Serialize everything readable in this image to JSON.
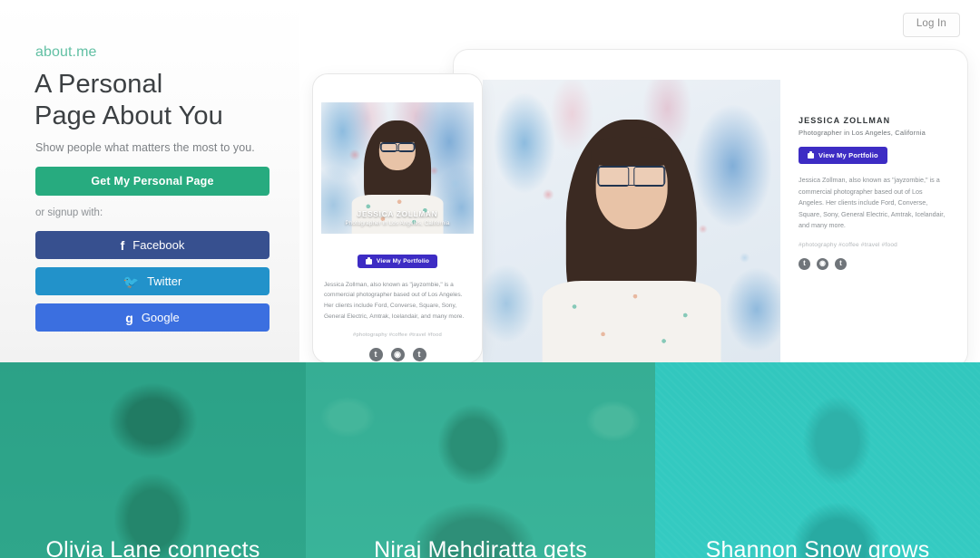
{
  "header": {
    "login_label": "Log In",
    "brand": "about.me"
  },
  "hero": {
    "headline_line1": "A Personal",
    "headline_line2": "Page About You",
    "subhead": "Show people what matters the most to you.",
    "cta_label": "Get My Personal Page",
    "or_label": "or signup with:",
    "social_buttons": [
      {
        "label": "Facebook",
        "glyph": "f",
        "color": "#37508f"
      },
      {
        "label": "Twitter",
        "glyph": "🐦",
        "color": "#2292ca"
      },
      {
        "label": "Google",
        "glyph": "g",
        "color": "#3b6fe0"
      }
    ]
  },
  "profile": {
    "name": "JESSICA ZOLLMAN",
    "role": "Photographer in Los Angeles, California",
    "portfolio_button": "View My Portfolio",
    "bio": "Jessica Zollman, also known as \"jayzombie,\" is a commercial photographer based out of Los Angeles. Her clients include Ford, Converse, Square, Sony, General Electric, Amtrak, Icelandair, and many more.",
    "tags": "#photography  #coffee  #travel  #food",
    "social": [
      {
        "name": "twitter",
        "glyph": "t"
      },
      {
        "name": "instagram",
        "glyph": "◉"
      },
      {
        "name": "tumblr",
        "glyph": "t"
      }
    ]
  },
  "tiles": [
    {
      "title": "Olivia Lane connects",
      "bg": "#2fa389"
    },
    {
      "title": "Niraj Mehdiratta gets",
      "bg": "#39b197"
    },
    {
      "title": "Shannon Snow grows",
      "bg": "#33c9c0"
    }
  ],
  "colors": {
    "brand_green": "#62c0a4",
    "cta_green": "#27ab7f",
    "portfolio_purple": "#3d2cc4"
  }
}
